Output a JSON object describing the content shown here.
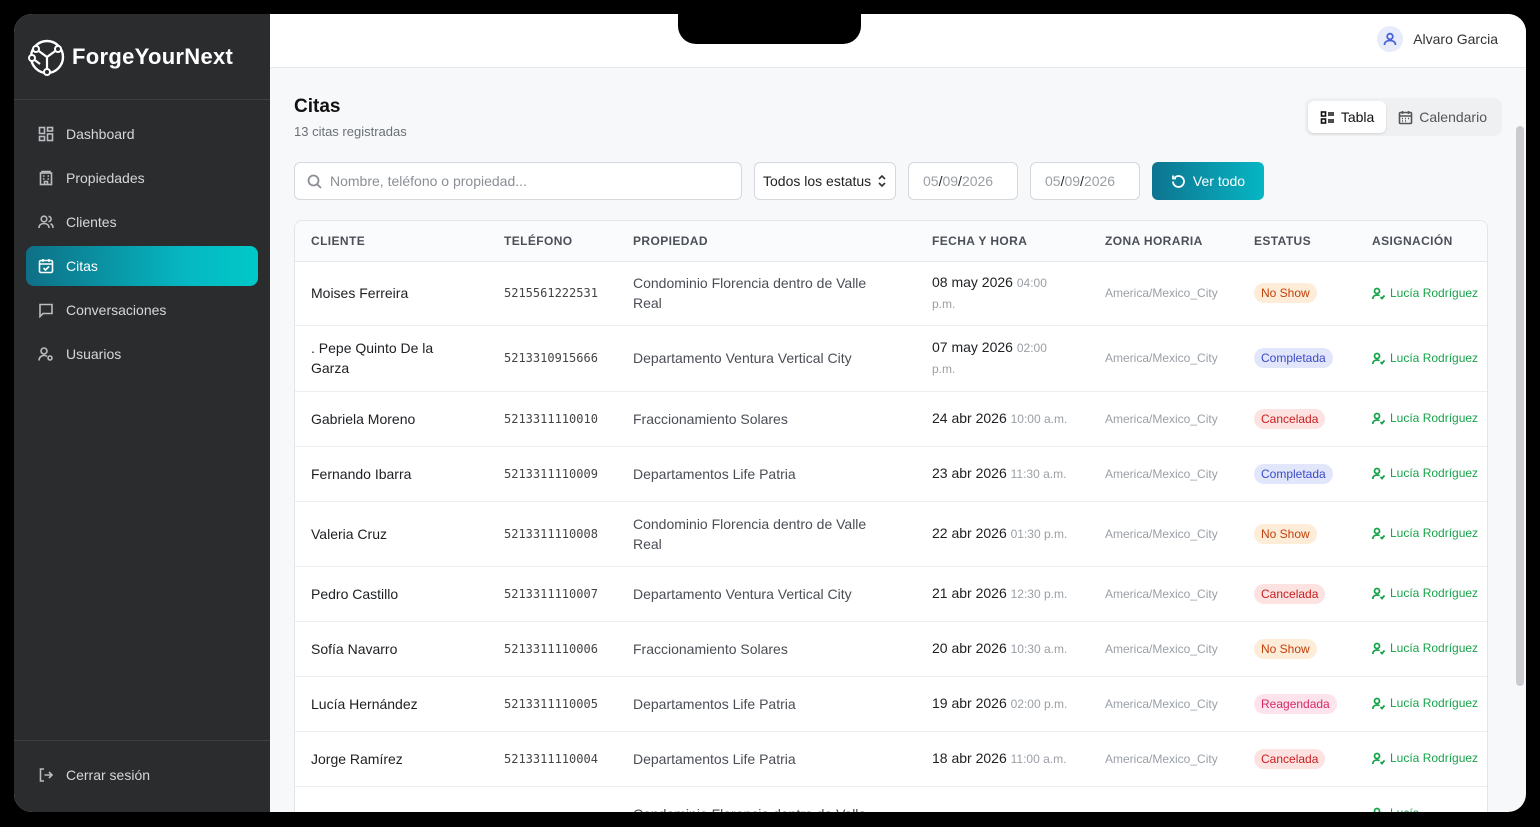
{
  "brand": {
    "name": "ForgeYourNext"
  },
  "sidebar": {
    "items": [
      {
        "label": "Dashboard",
        "icon": "dashboard-icon"
      },
      {
        "label": "Propiedades",
        "icon": "building-icon"
      },
      {
        "label": "Clientes",
        "icon": "users-icon"
      },
      {
        "label": "Citas",
        "icon": "calendar-icon",
        "active": true
      },
      {
        "label": "Conversaciones",
        "icon": "chat-icon"
      },
      {
        "label": "Usuarios",
        "icon": "user-gear-icon"
      }
    ],
    "logout": "Cerrar sesión"
  },
  "header": {
    "user_name": "Alvaro Garcia"
  },
  "page": {
    "title": "Citas",
    "subtitle": "13 citas registradas",
    "view_table": "Tabla",
    "view_calendar": "Calendario"
  },
  "filters": {
    "search_placeholder": "Nombre, teléfono o propiedad...",
    "status_value": "Todos los estatus",
    "date_from": {
      "dd": "05",
      "mm": "09",
      "yyyy": "2026"
    },
    "date_to": {
      "dd": "05",
      "mm": "09",
      "yyyy": "2026"
    },
    "ver_todo": "Ver todo"
  },
  "table": {
    "columns": [
      "Cliente",
      "Teléfono",
      "Propiedad",
      "Fecha y hora",
      "Zona horaria",
      "Estatus",
      "Asignación"
    ],
    "rows": [
      {
        "cliente": "Moises Ferreira",
        "telefono": "5215561222531",
        "propiedad": "Condominio Florencia dentro de Valle Real",
        "fecha": "08 may 2026",
        "hora": "04:00 p.m.",
        "zona": "America/Mexico_City",
        "estatus": "No Show",
        "asignacion": "Lucía Rodríguez"
      },
      {
        "cliente": ". Pepe Quinto De la Garza",
        "telefono": "5213310915666",
        "propiedad": "Departamento Ventura Vertical City",
        "fecha": "07 may 2026",
        "hora": "02:00 p.m.",
        "zona": "America/Mexico_City",
        "estatus": "Completada",
        "asignacion": "Lucía Rodríguez"
      },
      {
        "cliente": "Gabriela Moreno",
        "telefono": "5213311110010",
        "propiedad": "Fraccionamiento Solares",
        "fecha": "24 abr 2026",
        "hora": "10:00 a.m.",
        "zona": "America/Mexico_City",
        "estatus": "Cancelada",
        "asignacion": "Lucía Rodríguez"
      },
      {
        "cliente": "Fernando Ibarra",
        "telefono": "5213311110009",
        "propiedad": "Departamentos Life Patria",
        "fecha": "23 abr 2026",
        "hora": "11:30 a.m.",
        "zona": "America/Mexico_City",
        "estatus": "Completada",
        "asignacion": "Lucía Rodríguez"
      },
      {
        "cliente": "Valeria Cruz",
        "telefono": "5213311110008",
        "propiedad": "Condominio Florencia dentro de Valle Real",
        "fecha": "22 abr 2026",
        "hora": "01:30 p.m.",
        "zona": "America/Mexico_City",
        "estatus": "No Show",
        "asignacion": "Lucía Rodríguez"
      },
      {
        "cliente": "Pedro Castillo",
        "telefono": "5213311110007",
        "propiedad": "Departamento Ventura Vertical City",
        "fecha": "21 abr 2026",
        "hora": "12:30 p.m.",
        "zona": "America/Mexico_City",
        "estatus": "Cancelada",
        "asignacion": "Lucía Rodríguez"
      },
      {
        "cliente": "Sofía Navarro",
        "telefono": "5213311110006",
        "propiedad": "Fraccionamiento Solares",
        "fecha": "20 abr 2026",
        "hora": "10:30 a.m.",
        "zona": "America/Mexico_City",
        "estatus": "No Show",
        "asignacion": "Lucía Rodríguez"
      },
      {
        "cliente": "Lucía Hernández",
        "telefono": "5213311110005",
        "propiedad": "Departamentos Life Patria",
        "fecha": "19 abr 2026",
        "hora": "02:00 p.m.",
        "zona": "America/Mexico_City",
        "estatus": "Reagendada",
        "asignacion": "Lucía Rodríguez"
      },
      {
        "cliente": "Jorge Ramírez",
        "telefono": "5213311110004",
        "propiedad": "Departamentos Life Patria",
        "fecha": "18 abr 2026",
        "hora": "11:00 a.m.",
        "zona": "America/Mexico_City",
        "estatus": "Cancelada",
        "asignacion": "Lucía Rodríguez"
      },
      {
        "cliente": "",
        "telefono": "",
        "propiedad": "Condominio Florencia dentro de Valle",
        "fecha": "",
        "hora": "",
        "zona": "",
        "estatus": "",
        "asignacion": "Lucía"
      }
    ]
  },
  "colors": {
    "accent_start": "#0e7490",
    "accent_end": "#06b6c4",
    "sidebar_bg": "#2b2c2e",
    "assign_green": "#16a34a"
  }
}
